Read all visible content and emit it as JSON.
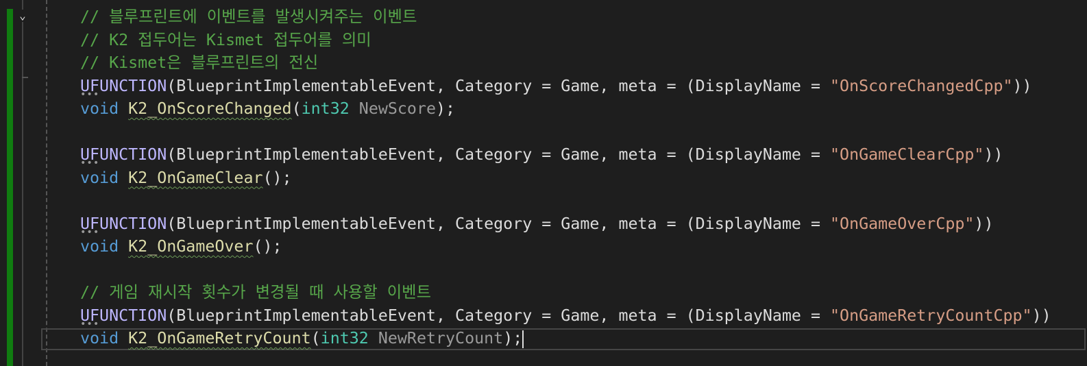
{
  "editor": {
    "lines": [
      [
        {
          "k": "comment",
          "t": "// 블루프린트에 이벤트를 발생시켜주는 이벤트"
        }
      ],
      [
        {
          "k": "comment",
          "t": "// K2 접두어는 Kismet 접두어를 의미"
        }
      ],
      [
        {
          "k": "comment",
          "t": "// Kismet은 블루프린트의 전신"
        }
      ],
      [
        {
          "k": "macro",
          "t": "UFUNCTION"
        },
        {
          "k": "plain",
          "t": "(BlueprintImplementableEvent, Category = Game, meta = (DisplayName = "
        },
        {
          "k": "str",
          "t": "\"OnScoreChangedCpp\""
        },
        {
          "k": "plain",
          "t": "))"
        }
      ],
      [
        {
          "k": "kw",
          "t": "void"
        },
        {
          "k": "plain",
          "t": " "
        },
        {
          "k": "fn",
          "t": "K2_OnScoreChanged"
        },
        {
          "k": "plain",
          "t": "("
        },
        {
          "k": "type",
          "t": "int32"
        },
        {
          "k": "plain",
          "t": " "
        },
        {
          "k": "param",
          "t": "NewScore"
        },
        {
          "k": "plain",
          "t": ");"
        }
      ],
      [],
      [
        {
          "k": "macro",
          "t": "UFUNCTION"
        },
        {
          "k": "plain",
          "t": "(BlueprintImplementableEvent, Category = Game, meta = (DisplayName = "
        },
        {
          "k": "str",
          "t": "\"OnGameClearCpp\""
        },
        {
          "k": "plain",
          "t": "))"
        }
      ],
      [
        {
          "k": "kw",
          "t": "void"
        },
        {
          "k": "plain",
          "t": " "
        },
        {
          "k": "fn",
          "t": "K2_OnGameClear"
        },
        {
          "k": "plain",
          "t": "();"
        }
      ],
      [],
      [
        {
          "k": "macro",
          "t": "UFUNCTION"
        },
        {
          "k": "plain",
          "t": "(BlueprintImplementableEvent, Category = Game, meta = (DisplayName = "
        },
        {
          "k": "str",
          "t": "\"OnGameOverCpp\""
        },
        {
          "k": "plain",
          "t": "))"
        }
      ],
      [
        {
          "k": "kw",
          "t": "void"
        },
        {
          "k": "plain",
          "t": " "
        },
        {
          "k": "fn",
          "t": "K2_OnGameOver"
        },
        {
          "k": "plain",
          "t": "();"
        }
      ],
      [],
      [
        {
          "k": "comment",
          "t": "// 게임 재시작 횟수가 변경될 때 사용할 이벤트"
        }
      ],
      [
        {
          "k": "macro",
          "t": "UFUNCTION"
        },
        {
          "k": "plain",
          "t": "(BlueprintImplementableEvent, Category = Game, meta = (DisplayName = "
        },
        {
          "k": "str",
          "t": "\"OnGameRetryCountCpp\""
        },
        {
          "k": "plain",
          "t": "))"
        }
      ],
      [
        {
          "k": "kw",
          "t": "void"
        },
        {
          "k": "plain",
          "t": " "
        },
        {
          "k": "fn",
          "t": "K2_OnGameRetryCount"
        },
        {
          "k": "plain",
          "t": "("
        },
        {
          "k": "type",
          "t": "int32"
        },
        {
          "k": "plain",
          "t": " "
        },
        {
          "k": "param",
          "t": "NewRetryCount"
        },
        {
          "k": "plain",
          "t": ");"
        }
      ]
    ],
    "caret_line": 14,
    "colors": {
      "background": "#1e1e1e",
      "change_bar": "#107c10",
      "comment": "#57a64a",
      "keyword": "#569cd6"
    }
  }
}
